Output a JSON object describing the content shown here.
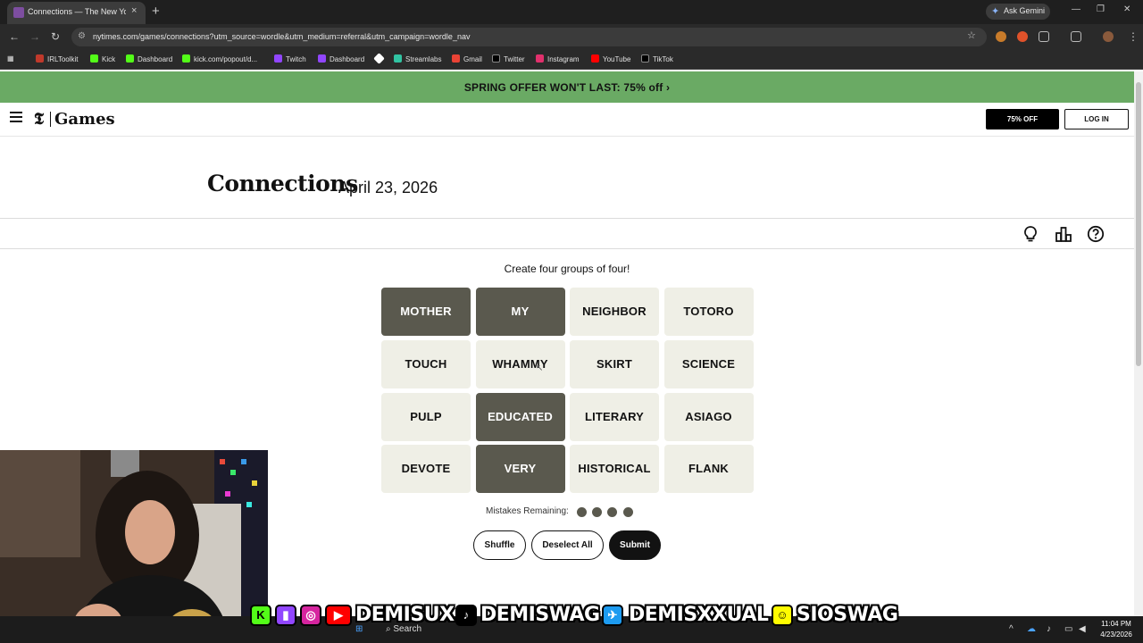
{
  "browser": {
    "tab_title": "Connections — The New York Times",
    "tab_close": "×",
    "new_tab": "+",
    "ask_gemini": "Ask Gemini",
    "url": "nytimes.com/games/connections?utm_source=wordle&utm_medium=referral&utm_campaign=wordle_nav",
    "bookmarks": [
      "IRLToolkit",
      "Kick",
      "Dashboard",
      "kick.com/popout/d...",
      "Twitch",
      "Dashboard",
      "",
      "Streamlabs",
      "Gmail",
      "Twitter",
      "Instagram",
      "YouTube",
      "TikTok"
    ]
  },
  "promo": {
    "text": "SPRING OFFER WON'T LAST:  75% off ›"
  },
  "header": {
    "logo_t": "𝕿",
    "logo_games": "Games",
    "offer_button": "75% OFF",
    "login_button": "LOG IN"
  },
  "game": {
    "title": "Connections",
    "date": "April 23, 2026",
    "instructions": "Create four groups of four!",
    "cards": [
      {
        "word": "MOTHER",
        "selected": true
      },
      {
        "word": "MY",
        "selected": true
      },
      {
        "word": "NEIGHBOR",
        "selected": false
      },
      {
        "word": "TOTORO",
        "selected": false
      },
      {
        "word": "TOUCH",
        "selected": false
      },
      {
        "word": "WHAMMY",
        "selected": false
      },
      {
        "word": "SKIRT",
        "selected": false
      },
      {
        "word": "SCIENCE",
        "selected": false
      },
      {
        "word": "PULP",
        "selected": false
      },
      {
        "word": "EDUCATED",
        "selected": true
      },
      {
        "word": "LITERARY",
        "selected": false
      },
      {
        "word": "ASIAGO",
        "selected": false
      },
      {
        "word": "DEVOTE",
        "selected": false
      },
      {
        "word": "VERY",
        "selected": true
      },
      {
        "word": "HISTORICAL",
        "selected": false
      },
      {
        "word": "FLANK",
        "selected": false
      }
    ],
    "mistakes_label": "Mistakes Remaining:",
    "mistakes_remaining": 4,
    "shuffle": "Shuffle",
    "deselect_all": "Deselect All",
    "submit": "Submit",
    "selected_color": "#5a594e",
    "card_color": "#efefe6",
    "promo_color": "#6aaa64"
  },
  "overlay": {
    "handle_1": "DEMISUX",
    "handle_2": "DEMISWAG",
    "handle_3": "DEMISXXUAL",
    "handle_4": "SIOSWAG"
  },
  "taskbar": {
    "search": "Search",
    "time": "11:04 PM",
    "date": "4/23/2026"
  }
}
